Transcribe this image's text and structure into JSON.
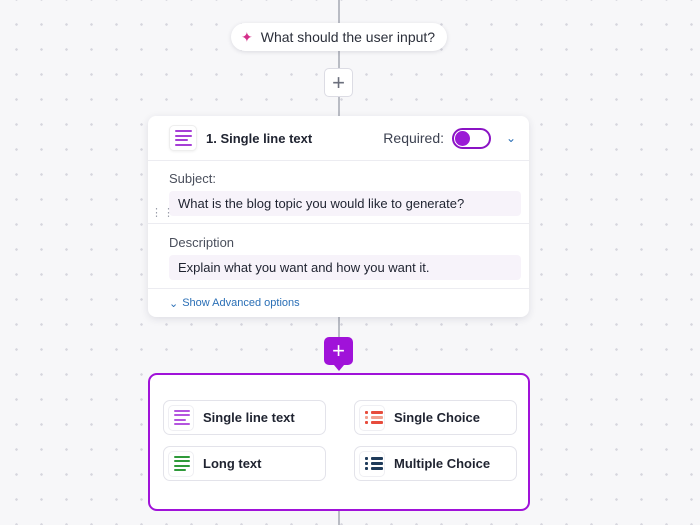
{
  "prompt": {
    "icon": "sparkle-icon",
    "text": "What should the user input?"
  },
  "field": {
    "number_title": "1. Single line text",
    "required_label": "Required:",
    "required_on": true,
    "subject_label": "Subject:",
    "subject_value": "What is the blog topic you would like to generate?",
    "description_label": "Description",
    "description_value": "Explain what you want and how you want it.",
    "advanced_label": "Show Advanced options"
  },
  "picker": {
    "options": [
      {
        "label": "Single line text",
        "icon": "single-line-text-icon"
      },
      {
        "label": "Single Choice",
        "icon": "single-choice-icon"
      },
      {
        "label": "Long text",
        "icon": "long-text-icon"
      },
      {
        "label": "Multiple Choice",
        "icon": "multiple-choice-icon"
      }
    ]
  },
  "colors": {
    "accent": "#a012d9",
    "link": "#2a6fb6",
    "sparkle": "#d42f8a"
  }
}
